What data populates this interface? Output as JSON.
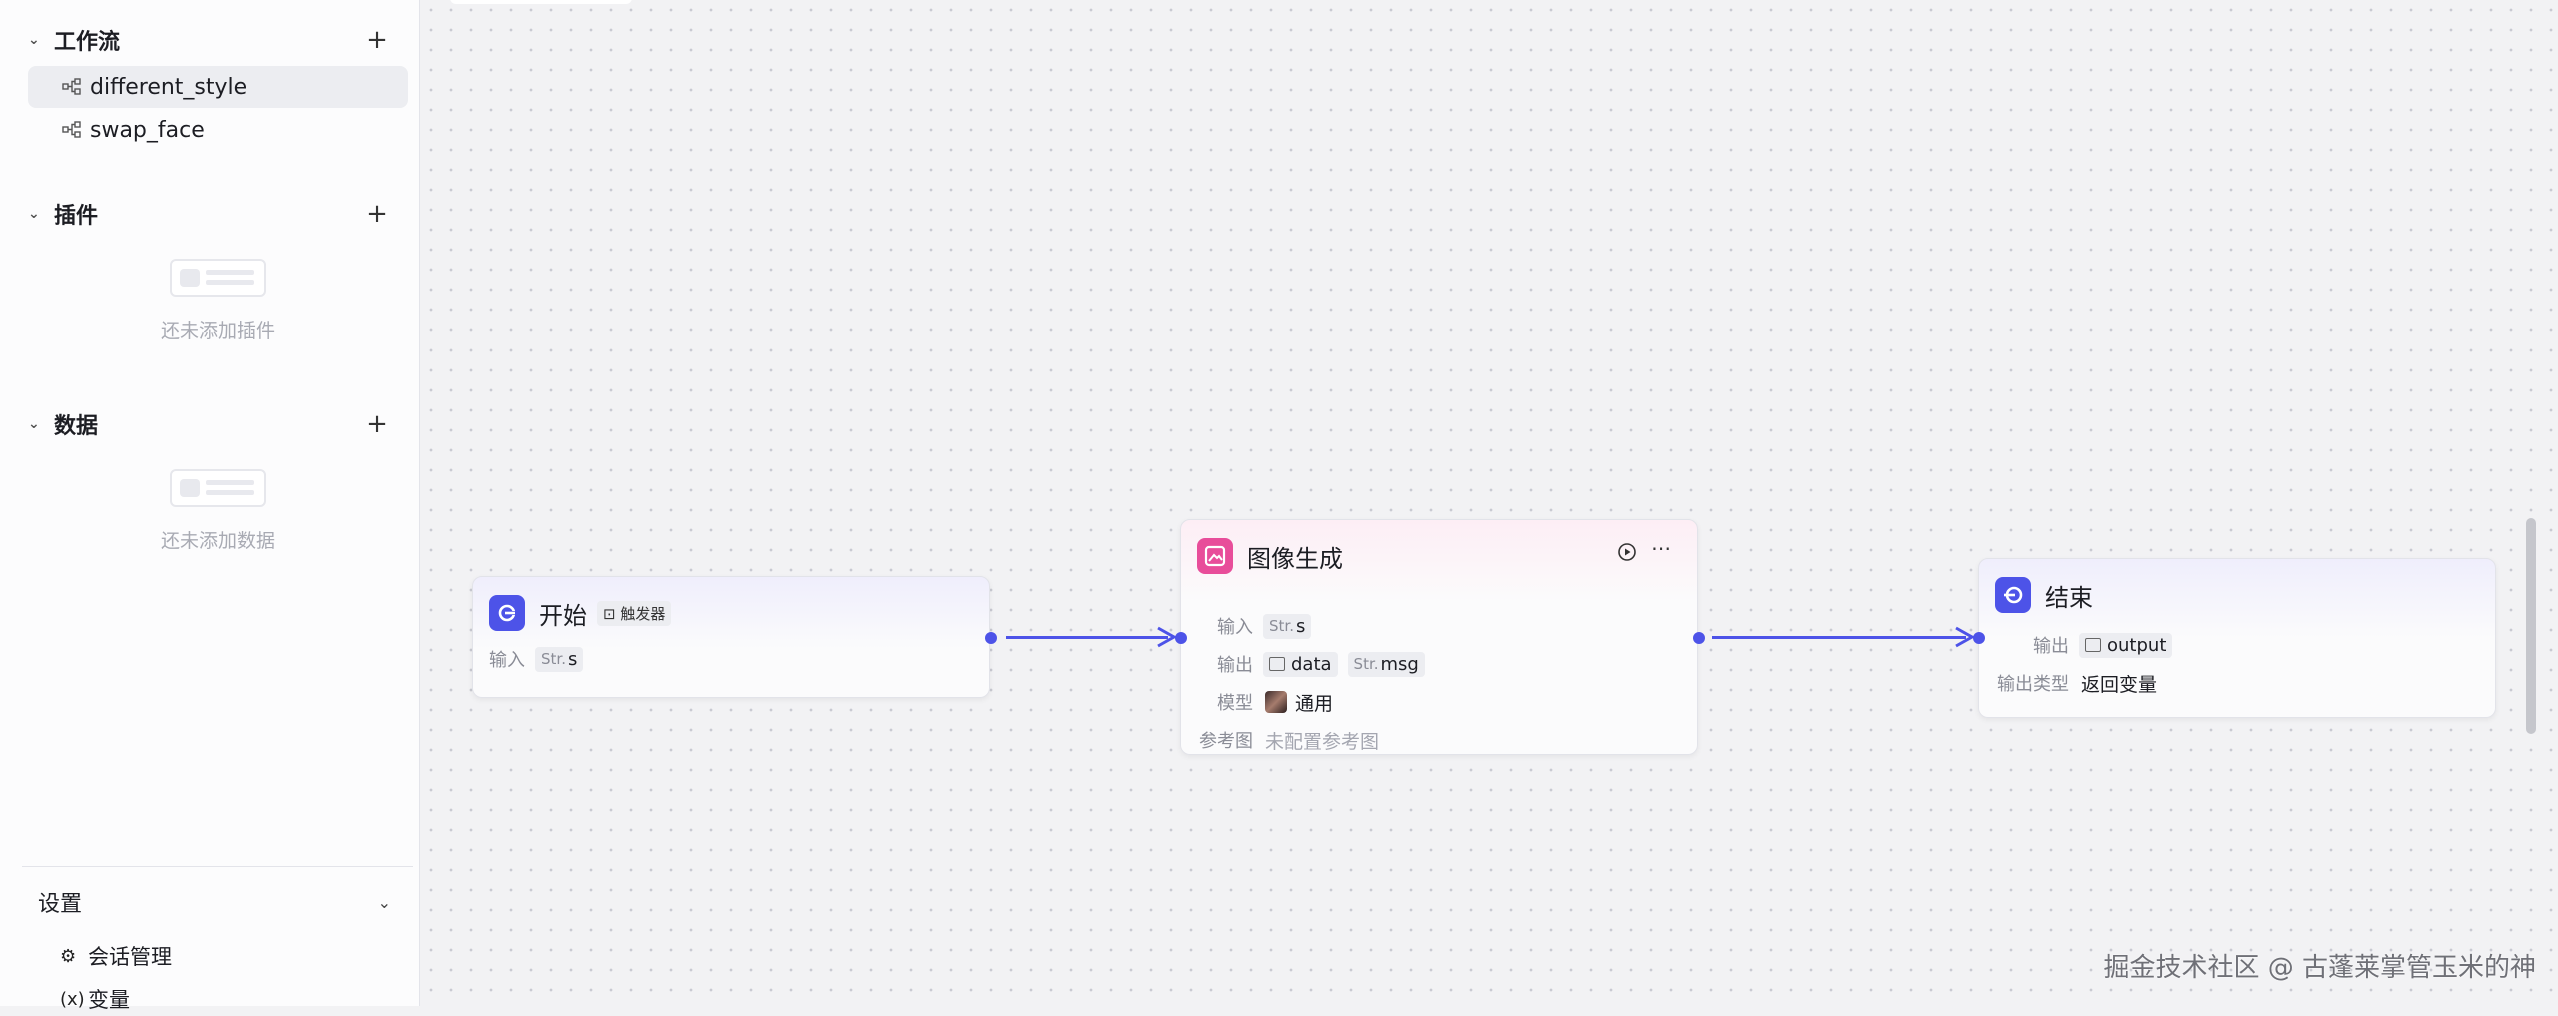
{
  "sidebar": {
    "workflow_section": {
      "title": "工作流",
      "add": "+"
    },
    "workflows": [
      {
        "label": "different_style",
        "active": true
      },
      {
        "label": "swap_face",
        "active": false
      }
    ],
    "plugin_section": {
      "title": "插件",
      "add": "+",
      "empty_text": "还未添加插件"
    },
    "data_section": {
      "title": "数据",
      "add": "+",
      "empty_text": "还未添加数据"
    },
    "settings": {
      "title": "设置",
      "items": [
        {
          "label": "会话管理",
          "icon": "chat-settings-icon"
        },
        {
          "label": "变量",
          "icon": "variable-icon"
        }
      ]
    }
  },
  "canvas": {
    "nodes": {
      "start": {
        "title": "开始",
        "badge": "触发器",
        "input_label": "输入",
        "input_type": "Str.",
        "input_name": "s"
      },
      "image_gen": {
        "title": "图像生成",
        "input_label": "输入",
        "input_type": "Str.",
        "input_name": "s",
        "output_label": "输出",
        "output_data": "data",
        "output_msg_type": "Str.",
        "output_msg": "msg",
        "model_label": "模型",
        "model_value": "通用",
        "ref_label": "参考图",
        "ref_value": "未配置参考图"
      },
      "end": {
        "title": "结束",
        "output_label": "输出",
        "output_name": "output",
        "output_type_label": "输出类型",
        "output_type_value": "返回变量"
      }
    },
    "colors": {
      "edge": "#4d53e8",
      "start_icon": "#4d53e8",
      "image_icon": "#e84d9a",
      "end_icon": "#4d53e8"
    }
  },
  "watermark": "掘金技术社区 @ 古蓬莱掌管玉米的神"
}
